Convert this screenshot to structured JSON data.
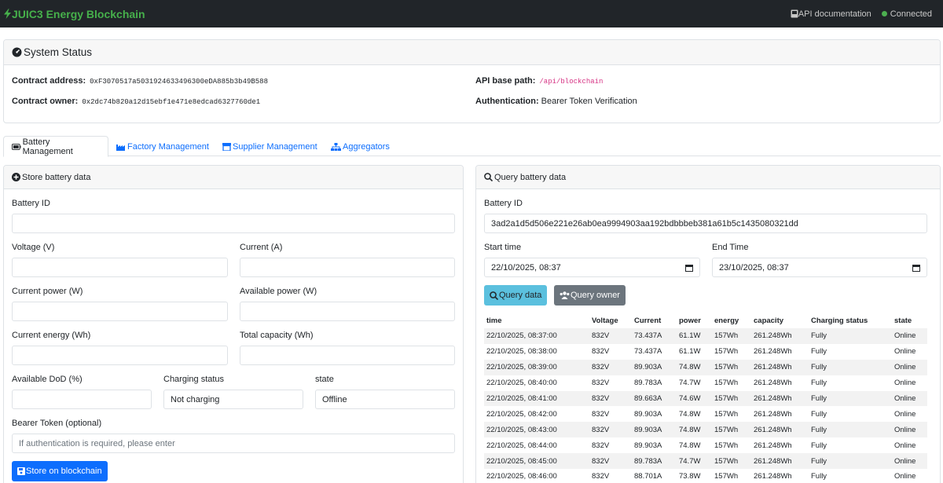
{
  "navbar": {
    "brand": "JUIC3 Energy Blockchain",
    "api_doc": "API documentation",
    "connection": "Connected",
    "connection_color": "#4caf50"
  },
  "system_status": {
    "title": "System Status",
    "contract_address_label": "Contract address:",
    "contract_address": "0xF3070517a5031924633496300eDA885b3b49B588",
    "contract_owner_label": "Contract owner:",
    "contract_owner": "0x2dc74b820a12d15ebf1e471e8edcad6327760de1",
    "api_base_label": "API base path:",
    "api_base": "/api/blockchain",
    "auth_label": "Authentication:",
    "auth": "Bearer Token Verification"
  },
  "tabs": [
    {
      "label": "Battery Management",
      "icon": "battery-icon",
      "active": true
    },
    {
      "label": "Factory Management",
      "icon": "factory-icon",
      "active": false
    },
    {
      "label": "Supplier Management",
      "icon": "box-icon",
      "active": false
    },
    {
      "label": "Aggregators",
      "icon": "network-icon",
      "active": false
    }
  ],
  "store": {
    "title": "Store battery data",
    "battery_id_label": "Battery ID",
    "battery_id_value": "",
    "voltage_label": "Voltage (V)",
    "current_label": "Current (A)",
    "current_power_label": "Current power (W)",
    "available_power_label": "Available power (W)",
    "current_energy_label": "Current energy (Wh)",
    "total_capacity_label": "Total capacity (Wh)",
    "dod_label": "Available DoD (%)",
    "charging_status_label": "Charging status",
    "charging_status_value": "Not charging",
    "state_label": "state",
    "state_value": "Offline",
    "token_label": "Bearer Token (optional)",
    "token_placeholder": "If authentication is required, please enter",
    "submit": "Store on blockchain"
  },
  "query": {
    "title": "Query battery data",
    "battery_id_label": "Battery ID",
    "battery_id_value": "3ad2a1d5d506e221e26ab0ea9994903aa192bdbbbeb381a61b5c1435080321dd",
    "start_label": "Start time",
    "start_value": "22/10/2025, 08:37",
    "end_label": "End Time",
    "end_value": "23/10/2025, 08:37",
    "query_data": "Query data",
    "query_owner": "Query owner",
    "columns": [
      "time",
      "Voltage",
      "Current",
      "power",
      "energy",
      "capacity",
      "Charging status",
      "state"
    ],
    "rows": [
      [
        "22/10/2025, 08:37:00",
        "832V",
        "73.437A",
        "61.1W",
        "157Wh",
        "261.248Wh",
        "Fully",
        "Online"
      ],
      [
        "22/10/2025, 08:38:00",
        "832V",
        "73.437A",
        "61.1W",
        "157Wh",
        "261.248Wh",
        "Fully",
        "Online"
      ],
      [
        "22/10/2025, 08:39:00",
        "832V",
        "89.903A",
        "74.8W",
        "157Wh",
        "261.248Wh",
        "Fully",
        "Online"
      ],
      [
        "22/10/2025, 08:40:00",
        "832V",
        "89.783A",
        "74.7W",
        "157Wh",
        "261.248Wh",
        "Fully",
        "Online"
      ],
      [
        "22/10/2025, 08:41:00",
        "832V",
        "89.663A",
        "74.6W",
        "157Wh",
        "261.248Wh",
        "Fully",
        "Online"
      ],
      [
        "22/10/2025, 08:42:00",
        "832V",
        "89.903A",
        "74.8W",
        "157Wh",
        "261.248Wh",
        "Fully",
        "Online"
      ],
      [
        "22/10/2025, 08:43:00",
        "832V",
        "89.903A",
        "74.8W",
        "157Wh",
        "261.248Wh",
        "Fully",
        "Online"
      ],
      [
        "22/10/2025, 08:44:00",
        "832V",
        "89.903A",
        "74.8W",
        "157Wh",
        "261.248Wh",
        "Fully",
        "Online"
      ],
      [
        "22/10/2025, 08:45:00",
        "832V",
        "89.783A",
        "74.7W",
        "157Wh",
        "261.248Wh",
        "Fully",
        "Online"
      ],
      [
        "22/10/2025, 08:46:00",
        "832V",
        "88.701A",
        "73.8W",
        "157Wh",
        "261.248Wh",
        "Fully",
        "Online"
      ]
    ]
  }
}
